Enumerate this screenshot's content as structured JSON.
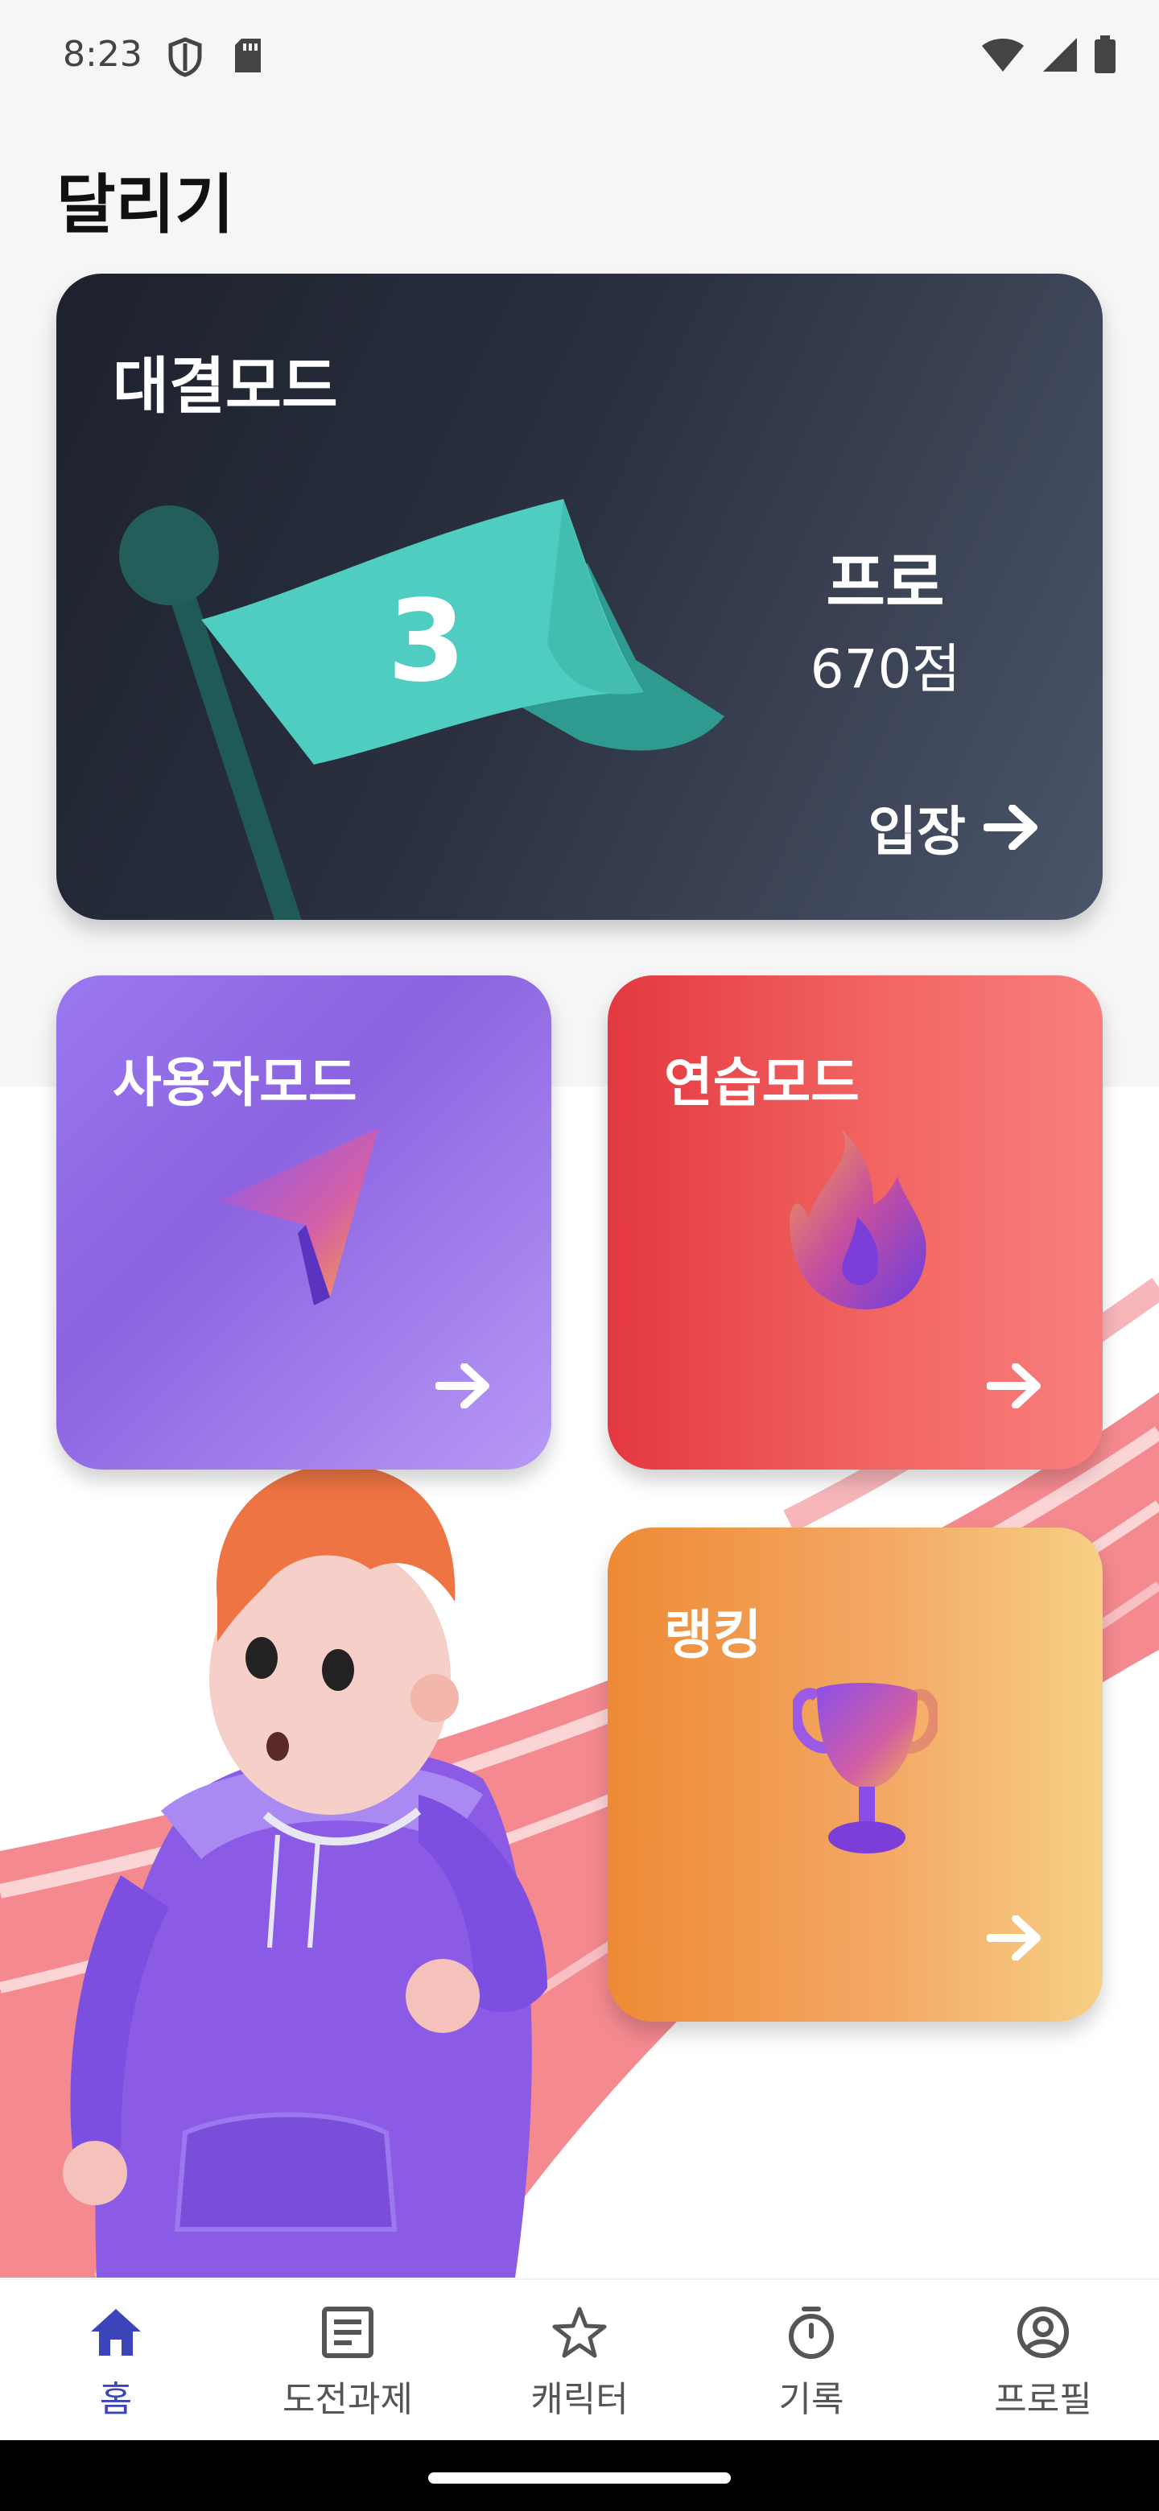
{
  "status_bar": {
    "time": "8:23"
  },
  "page": {
    "title": "달리기"
  },
  "battle_card": {
    "title": "대결모드",
    "flag_number": "3",
    "tier": "프로",
    "score": "670점",
    "enter_label": "입장"
  },
  "mode_cards": [
    {
      "title": "사용자모드",
      "icon": "navigation-arrow-icon"
    },
    {
      "title": "연습모드",
      "icon": "fire-icon"
    },
    {
      "title": "랭킹",
      "icon": "trophy-icon"
    }
  ],
  "bottom_nav": [
    {
      "label": "홈",
      "icon": "home-icon",
      "active": true
    },
    {
      "label": "도전과제",
      "icon": "document-icon",
      "active": false
    },
    {
      "label": "캐릭터",
      "icon": "star-icon",
      "active": false
    },
    {
      "label": "기록",
      "icon": "stopwatch-icon",
      "active": false
    },
    {
      "label": "프로필",
      "icon": "account-circle-icon",
      "active": false
    }
  ],
  "colors": {
    "accent": "#3b44b8",
    "battle_card": "#2a3040",
    "user_card": "#9a78f0",
    "practice_card": "#f26563",
    "ranking_card": "#f3a864"
  }
}
